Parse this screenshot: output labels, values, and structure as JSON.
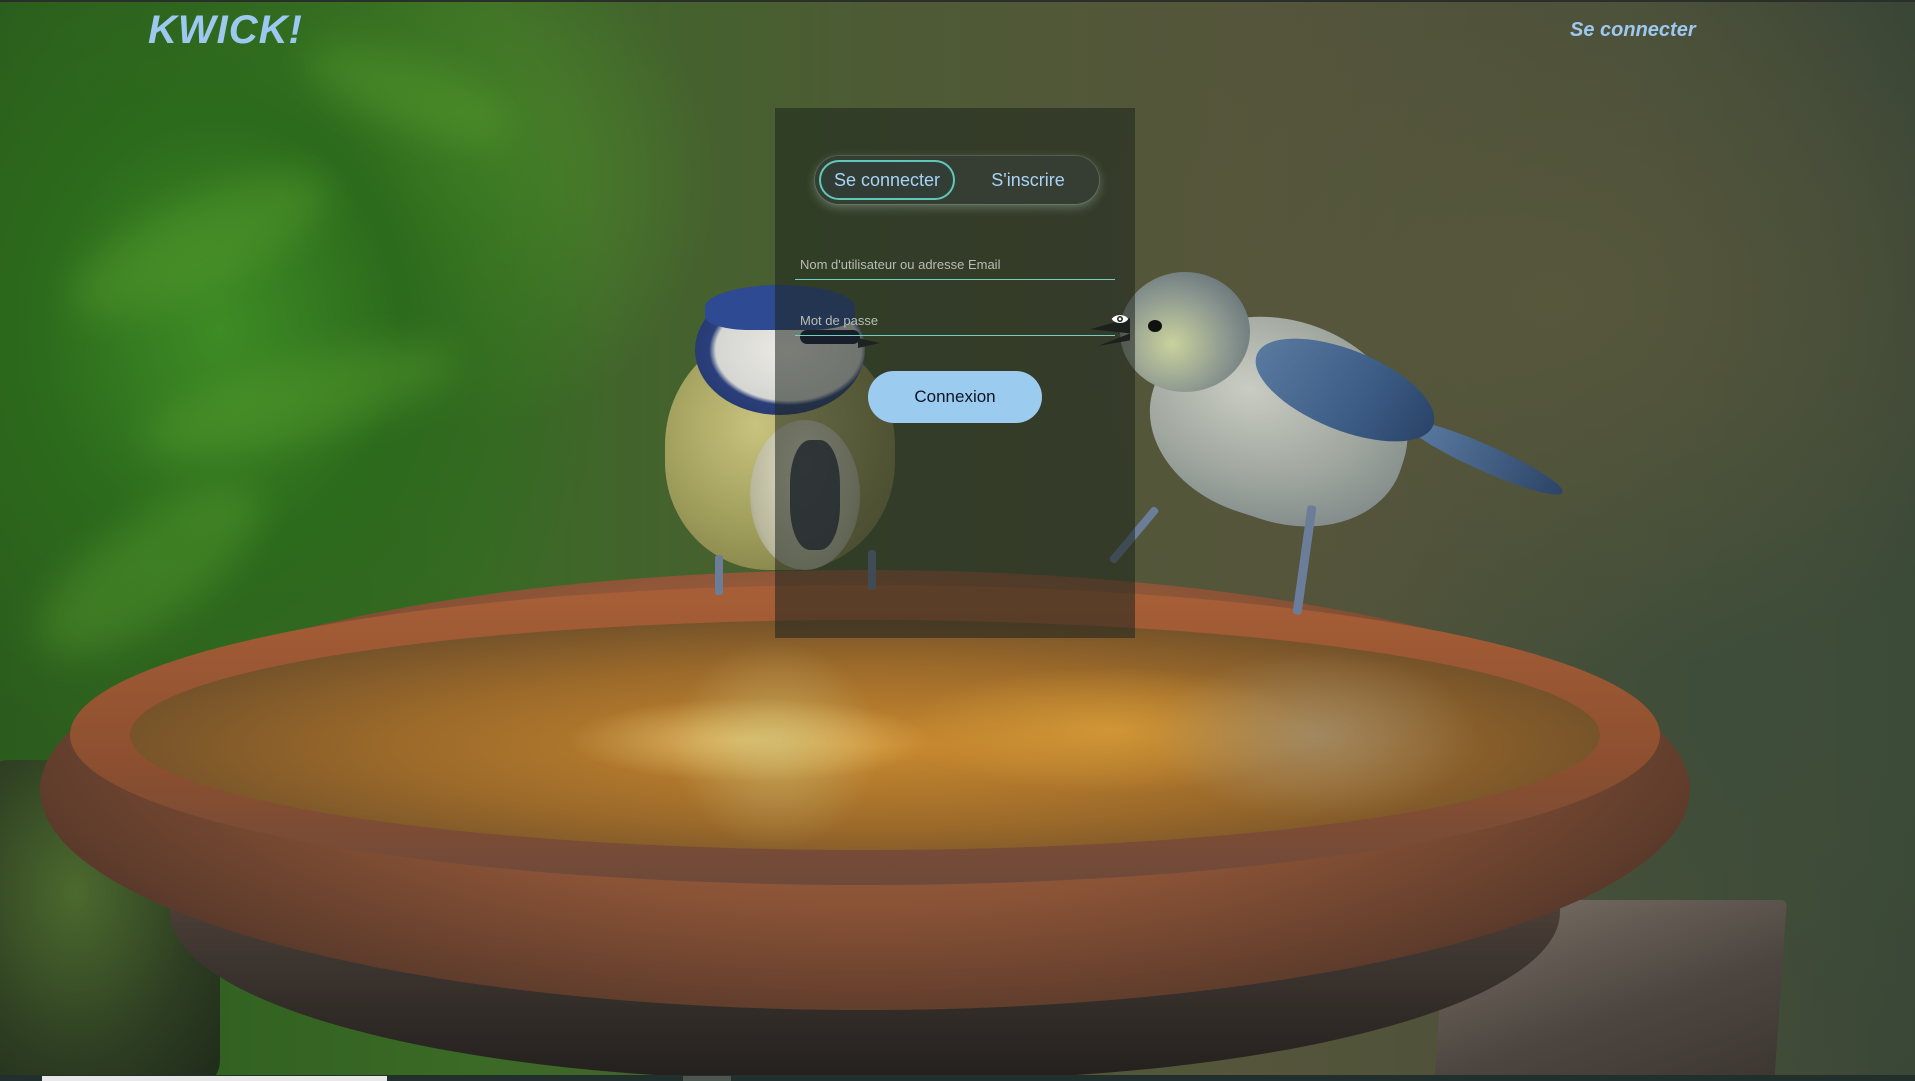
{
  "header": {
    "brand": "KWICK!",
    "nav_login": "Se connecter"
  },
  "auth_panel": {
    "tabs": [
      {
        "label": "Se connecter",
        "active": true
      },
      {
        "label": "S'inscrire",
        "active": false
      }
    ],
    "username_field": {
      "placeholder": "Nom d'utilisateur ou adresse Email",
      "value": ""
    },
    "password_field": {
      "placeholder": "Mot de passe",
      "value": "",
      "toggle_icon": "eye-icon"
    },
    "submit_label": "Connexion"
  },
  "colors": {
    "accent": "#9dc8ef",
    "tab_border": "#5fc8b8",
    "button_bg": "#9ccbf0"
  }
}
